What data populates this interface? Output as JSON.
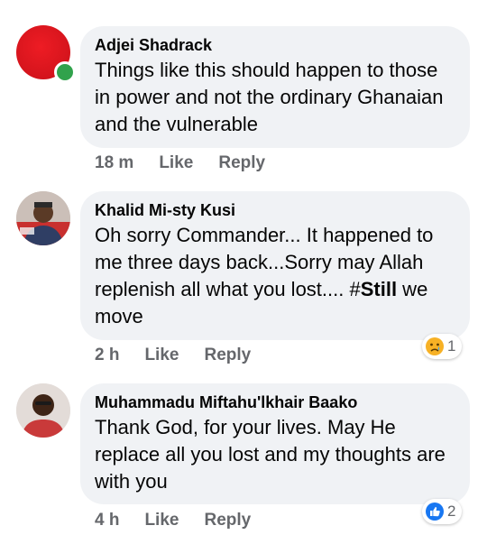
{
  "comments": [
    {
      "author": "Adjei Shadrack",
      "text": "Things like this should happen to those in power and not the ordinary Ghanaian and the vulnerable",
      "time": "18 m",
      "like": "Like",
      "reply": "Reply"
    },
    {
      "author": "Khalid Mi-sty Kusi",
      "text_prefix": "Oh sorry Commander... It happened to me three days back...Sorry may Allah replenish all what you lost.... #",
      "text_bold": "Still",
      "text_suffix": " we move",
      "time": "2 h",
      "like": "Like",
      "reply": "Reply",
      "reaction": {
        "icon": "sad-face-icon",
        "count": "1"
      }
    },
    {
      "author": "Muhammadu Miftahu'lkhair Baako",
      "text": "Thank God, for your lives. May He replace all you lost and my thoughts are with you",
      "time": "4 h",
      "like": "Like",
      "reply": "Reply",
      "reaction": {
        "icon": "thumbs-up-icon",
        "count": "2"
      }
    }
  ],
  "colors": {
    "bubble": "#f0f2f5",
    "meta_text": "#65676b",
    "online": "#31a24c",
    "like_blue": "#1877f2"
  }
}
